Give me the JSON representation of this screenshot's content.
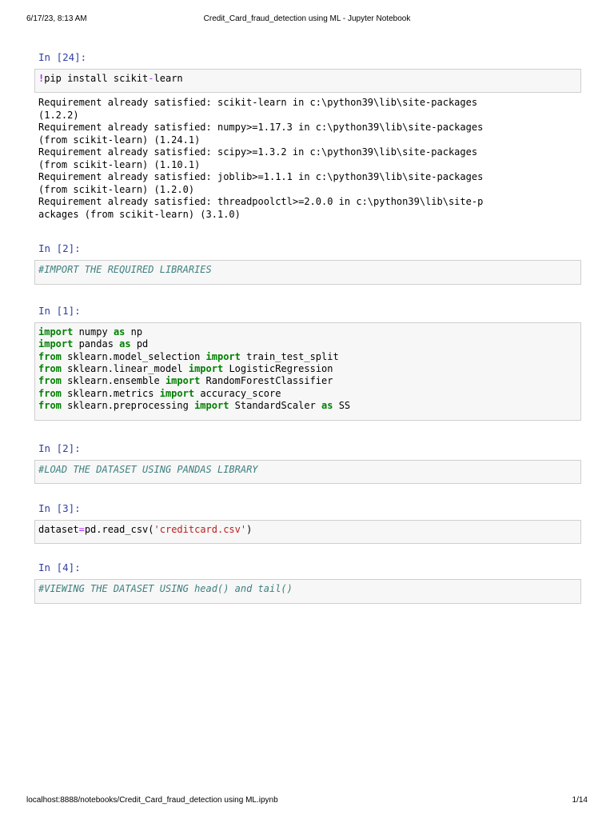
{
  "header": {
    "datetime": "6/17/23, 8:13 AM",
    "title": "Credit_Card_fraud_detection using ML - Jupyter Notebook"
  },
  "footer": {
    "url": "localhost:8888/notebooks/Credit_Card_fraud_detection using ML.ipynb",
    "page": "1/14"
  },
  "cells": [
    {
      "prompt": "In [24]:",
      "code": [
        [
          [
            "m",
            "!"
          ],
          [
            "t",
            "pip install scikit"
          ],
          [
            "o",
            "-"
          ],
          [
            "t",
            "learn"
          ]
        ]
      ],
      "output": [
        "Requirement already satisfied: scikit-learn in c:\\python39\\lib\\site-packages",
        "(1.2.2)",
        "Requirement already satisfied: numpy>=1.17.3 in c:\\python39\\lib\\site-packages",
        "(from scikit-learn) (1.24.1)",
        "Requirement already satisfied: scipy>=1.3.2 in c:\\python39\\lib\\site-packages",
        "(from scikit-learn) (1.10.1)",
        "Requirement already satisfied: joblib>=1.1.1 in c:\\python39\\lib\\site-packages",
        "(from scikit-learn) (1.2.0)",
        "Requirement already satisfied: threadpoolctl>=2.0.0 in c:\\python39\\lib\\site-p",
        "ackages (from scikit-learn) (3.1.0)"
      ]
    },
    {
      "prompt": "In [2]:",
      "code": [
        [
          [
            "c",
            "#IMPORT THE REQUIRED LIBRARIES"
          ]
        ]
      ]
    },
    {
      "prompt": "In [1]:",
      "code": [
        [
          [
            "k",
            "import"
          ],
          [
            "t",
            " numpy "
          ],
          [
            "k",
            "as"
          ],
          [
            "t",
            " np"
          ]
        ],
        [
          [
            "k",
            "import"
          ],
          [
            "t",
            " pandas "
          ],
          [
            "k",
            "as"
          ],
          [
            "t",
            " pd"
          ]
        ],
        [
          [
            "k",
            "from"
          ],
          [
            "t",
            " sklearn.model_selection "
          ],
          [
            "k",
            "import"
          ],
          [
            "t",
            " train_test_split"
          ]
        ],
        [
          [
            "k",
            "from"
          ],
          [
            "t",
            " sklearn.linear_model "
          ],
          [
            "k",
            "import"
          ],
          [
            "t",
            " LogisticRegression"
          ]
        ],
        [
          [
            "k",
            "from"
          ],
          [
            "t",
            " sklearn.ensemble "
          ],
          [
            "k",
            "import"
          ],
          [
            "t",
            " RandomForestClassifier"
          ]
        ],
        [
          [
            "k",
            "from"
          ],
          [
            "t",
            " sklearn.metrics "
          ],
          [
            "k",
            "import"
          ],
          [
            "t",
            " accuracy_score"
          ]
        ],
        [
          [
            "k",
            "from"
          ],
          [
            "t",
            " sklearn.preprocessing "
          ],
          [
            "k",
            "import"
          ],
          [
            "t",
            " StandardScaler "
          ],
          [
            "k",
            "as"
          ],
          [
            "t",
            " SS"
          ]
        ]
      ]
    },
    {
      "prompt": "In [2]:",
      "code": [
        [
          [
            "c",
            "#LOAD THE DATASET USING PANDAS LIBRARY"
          ]
        ]
      ]
    },
    {
      "prompt": "In [3]:",
      "code": [
        [
          [
            "t",
            "dataset"
          ],
          [
            "o",
            "="
          ],
          [
            "t",
            "pd.read_csv("
          ],
          [
            "s",
            "'creditcard.csv'"
          ],
          [
            "t",
            ")"
          ]
        ]
      ]
    },
    {
      "prompt": "In [4]:",
      "code": [
        [
          [
            "c",
            "#VIEWING THE DATASET USING head() and tail()"
          ]
        ]
      ]
    }
  ]
}
